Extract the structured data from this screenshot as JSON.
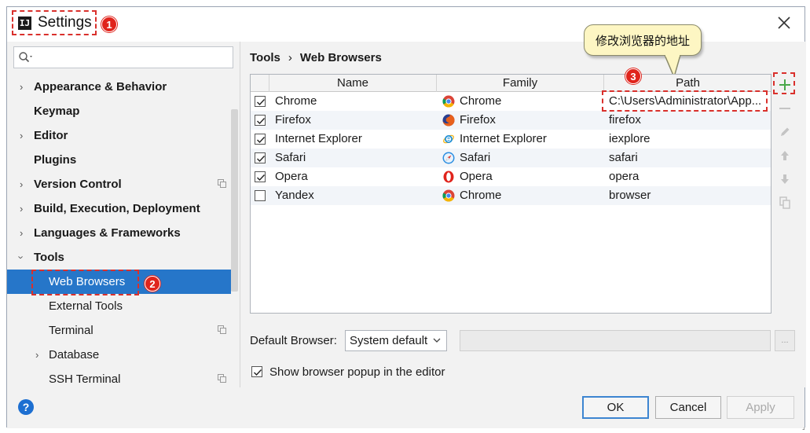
{
  "window": {
    "title": "Settings"
  },
  "annotations": {
    "badge1": "1",
    "badge2": "2",
    "badge3": "3",
    "callout_text": "修改浏览器的地址"
  },
  "sidebar": {
    "search_placeholder": "",
    "items": [
      {
        "label": "Appearance & Behavior",
        "expandable": true
      },
      {
        "label": "Keymap",
        "expandable": false
      },
      {
        "label": "Editor",
        "expandable": true
      },
      {
        "label": "Plugins",
        "expandable": false
      },
      {
        "label": "Version Control",
        "expandable": true,
        "project_icon": true
      },
      {
        "label": "Build, Execution, Deployment",
        "expandable": true
      },
      {
        "label": "Languages & Frameworks",
        "expandable": true
      },
      {
        "label": "Tools",
        "expandable": true,
        "expanded": true
      },
      {
        "label": "Web Browsers",
        "selected": true
      },
      {
        "label": "External Tools"
      },
      {
        "label": "Terminal",
        "project_icon": true
      },
      {
        "label": "Database",
        "expandable": true
      },
      {
        "label": "SSH Terminal",
        "project_icon": true
      }
    ]
  },
  "breadcrumb": {
    "parent": "Tools",
    "separator": "›",
    "current": "Web Browsers"
  },
  "table": {
    "columns": [
      "Name",
      "Family",
      "Path"
    ],
    "rows": [
      {
        "checked": true,
        "name": "Chrome",
        "family": "Chrome",
        "family_icon": "chrome-icon",
        "path": "C:\\Users\\Administrator\\App..."
      },
      {
        "checked": true,
        "name": "Firefox",
        "family": "Firefox",
        "family_icon": "firefox-icon",
        "path": "firefox"
      },
      {
        "checked": true,
        "name": "Internet Explorer",
        "family": "Internet Explorer",
        "family_icon": "ie-icon",
        "path": "iexplore"
      },
      {
        "checked": true,
        "name": "Safari",
        "family": "Safari",
        "family_icon": "safari-icon",
        "path": "safari"
      },
      {
        "checked": true,
        "name": "Opera",
        "family": "Opera",
        "family_icon": "opera-icon",
        "path": "opera"
      },
      {
        "checked": false,
        "name": "Yandex",
        "family": "Chrome",
        "family_icon": "chrome-icon",
        "path": "browser"
      }
    ]
  },
  "toolbar_icons": [
    "add-icon",
    "remove-icon",
    "edit-icon",
    "move-up-icon",
    "move-down-icon",
    "copy-icon"
  ],
  "default_browser": {
    "label": "Default Browser:",
    "selected": "System default",
    "path_value": "",
    "browse_label": "..."
  },
  "popup_option": {
    "label": "Show browser popup in the editor",
    "checked": true
  },
  "buttons": {
    "ok": "OK",
    "cancel": "Cancel",
    "apply": "Apply"
  },
  "colors": {
    "selection": "#2676c9",
    "annotation_red": "#e0241c",
    "callout_bg": "#fdf6c3",
    "add_green": "#4aa84a"
  }
}
